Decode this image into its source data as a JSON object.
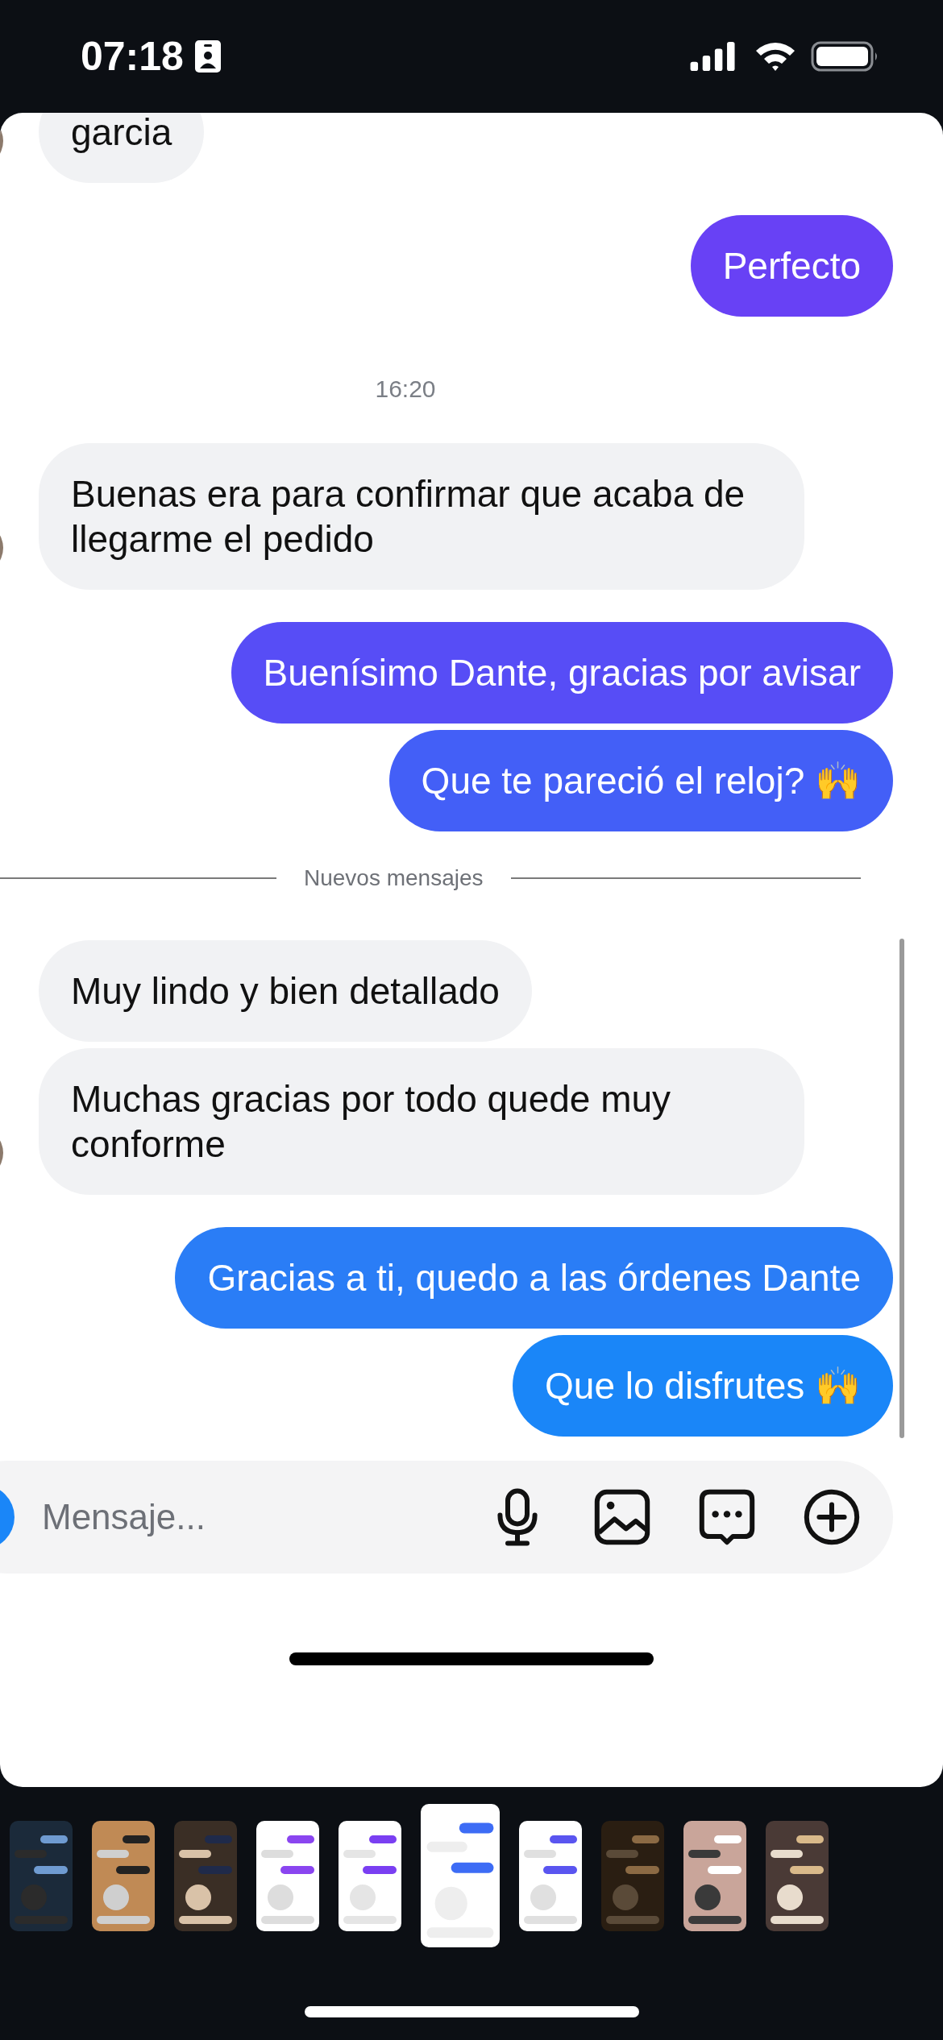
{
  "status_bar": {
    "time": "07:18"
  },
  "messages": [
    {
      "kind": "received",
      "text": "garcia",
      "avatar": true
    },
    {
      "kind": "sent",
      "text": "Perfecto",
      "color": "#6841f5"
    },
    {
      "kind": "time",
      "text": "16:20"
    },
    {
      "kind": "received",
      "text": "Buenas era para confirmar que acaba de llegarme el pedido",
      "avatar": true
    },
    {
      "kind": "sent",
      "text": "Buenísimo Dante, gracias por avisar",
      "color": "#574df6"
    },
    {
      "kind": "sent",
      "text": "Que te pareció el reloj? 🙌",
      "color": "#435ff7"
    },
    {
      "kind": "divider",
      "text": "Nuevos mensajes"
    },
    {
      "kind": "received",
      "text": "Muy lindo y bien detallado",
      "avatar": false
    },
    {
      "kind": "received",
      "text": "Muchas gracias por todo quede muy conforme",
      "avatar": true
    },
    {
      "kind": "sent",
      "text": "Gracias a ti, quedo a las órdenes Dante",
      "color": "#2a7df6"
    },
    {
      "kind": "sent",
      "text": "Que lo disfrutes 🙌",
      "color": "#1a86f8"
    }
  ],
  "composer": {
    "placeholder": "Mensaje..."
  },
  "thumbnails": [
    {
      "kind": "picture",
      "selected": false
    },
    {
      "kind": "picture",
      "selected": false
    },
    {
      "kind": "picture",
      "selected": false
    },
    {
      "kind": "picture",
      "selected": false
    },
    {
      "kind": "picture",
      "selected": false
    },
    {
      "kind": "picture",
      "selected": true
    },
    {
      "kind": "picture",
      "selected": false
    },
    {
      "kind": "picture",
      "selected": false
    },
    {
      "kind": "picture",
      "selected": false
    },
    {
      "kind": "picture",
      "selected": false
    }
  ]
}
